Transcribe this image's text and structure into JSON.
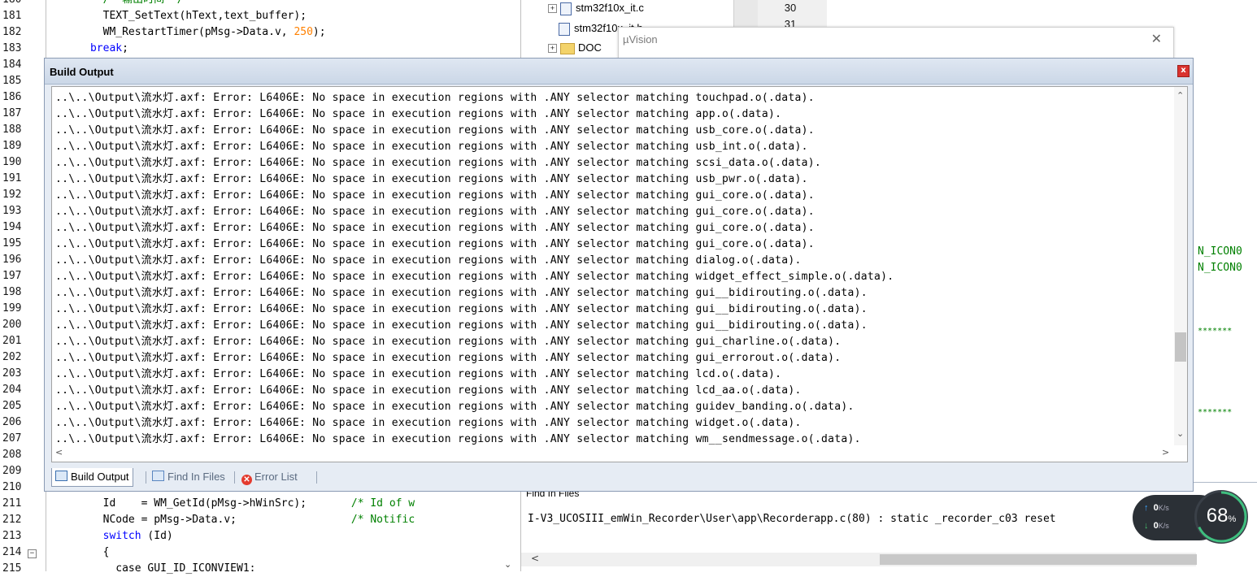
{
  "editor": {
    "line_numbers": [
      "180",
      "181",
      "182",
      "183",
      "184",
      "185",
      "186",
      "187",
      "188",
      "189",
      "190",
      "191",
      "192",
      "193",
      "194",
      "195",
      "196",
      "197",
      "198",
      "199",
      "200",
      "201",
      "202",
      "203",
      "204",
      "205",
      "206",
      "207",
      "208",
      "209",
      "210",
      "211",
      "212",
      "213",
      "214",
      "215"
    ],
    "top_lines": [
      {
        "indent": "        ",
        "parts": [
          {
            "t": "/* 输出时间 */",
            "c": "cm"
          }
        ]
      },
      {
        "indent": "        ",
        "parts": [
          {
            "t": "TEXT_SetText(hText,text_buffer);",
            "c": ""
          }
        ]
      },
      {
        "indent": "        ",
        "parts": [
          {
            "t": "WM_RestartTimer(pMsg->Data.v, ",
            "c": ""
          },
          {
            "t": "250",
            "c": "num"
          },
          {
            "t": ");",
            "c": ""
          }
        ]
      },
      {
        "indent": "      ",
        "parts": [
          {
            "t": "break",
            "c": "kw"
          },
          {
            "t": ";",
            "c": ""
          }
        ]
      }
    ],
    "bottom_lines": [
      {
        "indent": "        ",
        "parts": [
          {
            "t": "Id    = WM_GetId(pMsg->hWinSrc);",
            "c": ""
          },
          {
            "t": "       /* Id of w",
            "c": "cm"
          }
        ]
      },
      {
        "indent": "        ",
        "parts": [
          {
            "t": "NCode = pMsg->Data.v;",
            "c": ""
          },
          {
            "t": "                  /* Notific",
            "c": "cm"
          }
        ]
      },
      {
        "indent": "        ",
        "parts": [
          {
            "t": "switch",
            "c": "kw"
          },
          {
            "t": " (Id)",
            "c": ""
          }
        ]
      },
      {
        "indent": "        ",
        "parts": [
          {
            "t": "{",
            "c": ""
          }
        ]
      },
      {
        "indent": "          ",
        "parts": [
          {
            "t": "case GUI_ID_ICONVIEW1:",
            "c": ""
          }
        ]
      }
    ]
  },
  "project_tree": {
    "items": [
      {
        "label": "stm32f10x_it.c",
        "expander": "+"
      },
      {
        "label": "stm32f10x_it.h",
        "expander": ""
      },
      {
        "label": "DOC",
        "expander": "+"
      }
    ],
    "numbers": [
      "30",
      "31"
    ]
  },
  "uvision_popup": {
    "title": "µVision",
    "close": "✕"
  },
  "right_editor_fragments": [
    "N_ICON0",
    "N_ICON0",
    "*******",
    "*******"
  ],
  "build_output": {
    "title": "Build Output",
    "close": "x",
    "prefix": "..\\..\\Output\\流水灯.axf: Error: L6406E: No space in execution regions with .ANY selector matching ",
    "lines": [
      "touchpad.o(.data).",
      "app.o(.data).",
      "usb_core.o(.data).",
      "usb_int.o(.data).",
      "scsi_data.o(.data).",
      "usb_pwr.o(.data).",
      "gui_core.o(.data).",
      "gui_core.o(.data).",
      "gui_core.o(.data).",
      "gui_core.o(.data).",
      "dialog.o(.data).",
      "widget_effect_simple.o(.data).",
      "gui__bidirouting.o(.data).",
      "gui__bidirouting.o(.data).",
      "gui__bidirouting.o(.data).",
      "gui_charline.o(.data).",
      "gui_errorout.o(.data).",
      "lcd.o(.data).",
      "lcd_aa.o(.data).",
      "guidev_banding.o(.data).",
      "widget.o(.data).",
      "wm__sendmessage.o(.data)."
    ],
    "tabs": [
      {
        "label": "Build Output",
        "active": true
      },
      {
        "label": "Find In Files",
        "active": false
      },
      {
        "label": "Error List",
        "active": false
      }
    ]
  },
  "find_in_files": {
    "title": "Find In Files",
    "line": "I-V3_UCOSIII_emWin_Recorder\\User\\app\\Recorderapp.c(80) : static _recorder_c03 reset"
  },
  "speed_widget": {
    "up": "0",
    "down": "0",
    "unit": "K/s",
    "percent": "68",
    "percent_sign": "%",
    "level": 0.68,
    "colors": {
      "arc": "#3fbf7f",
      "pill": "#2b3036",
      "up": "#3da5ff",
      "down": "#47c26d"
    }
  },
  "colors": {
    "keyword": "#0000ff",
    "number": "#ff8000",
    "comment": "#008000",
    "error_close": "#d9322e"
  }
}
